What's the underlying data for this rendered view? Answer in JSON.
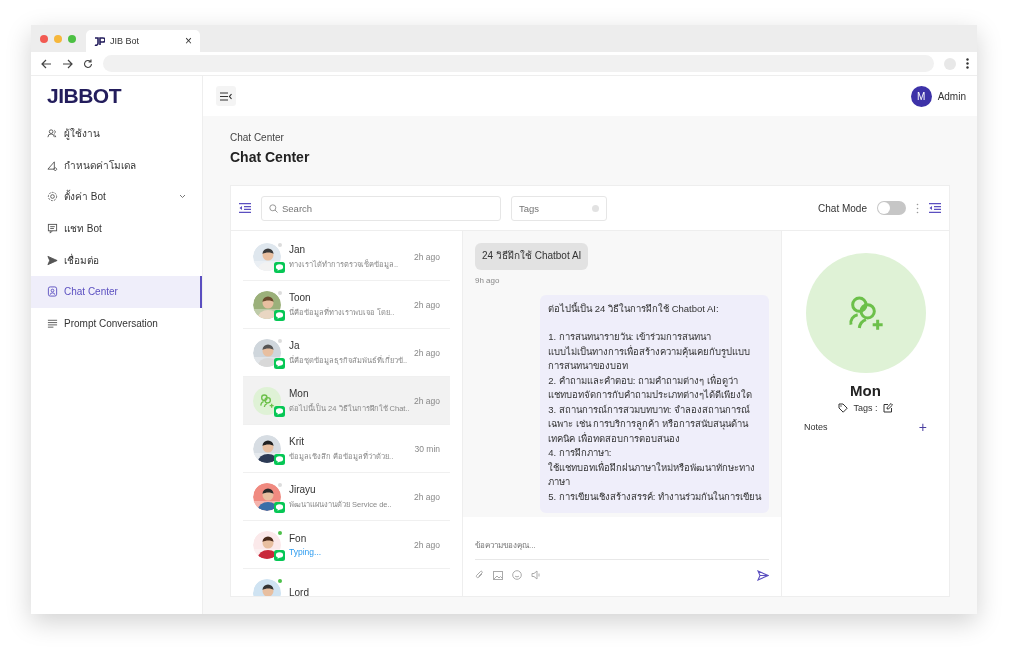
{
  "browser": {
    "tab_title": "JIB Bot",
    "tab_close": "×"
  },
  "sidebar": {
    "logo": "JIBBOT",
    "items": [
      {
        "label": "ผู้ใช้งาน",
        "selected": false,
        "expandable": false
      },
      {
        "label": "กำหนดค่าโมเดล",
        "selected": false,
        "expandable": false
      },
      {
        "label": "ตั้งค่า Bot",
        "selected": false,
        "expandable": true
      },
      {
        "label": "แชท Bot",
        "selected": false,
        "expandable": false
      },
      {
        "label": "เชื่อมต่อ",
        "selected": false,
        "expandable": false
      },
      {
        "label": "Chat Center",
        "selected": true,
        "expandable": false
      },
      {
        "label": "Prompt Conversation",
        "selected": false,
        "expandable": false
      }
    ]
  },
  "header": {
    "avatar_initial": "M",
    "user": "Admin"
  },
  "page": {
    "breadcrumb": "Chat Center",
    "title": "Chat Center"
  },
  "toolbar": {
    "search_placeholder": "Search",
    "tags_placeholder": "Tags",
    "chat_mode_label": "Chat Mode",
    "chat_mode_on": false
  },
  "contacts": [
    {
      "name": "Jan",
      "preview": "ทางเราได้ทำการตรวจเช็คข้อมูล..",
      "time": "2h ago",
      "selected": false,
      "online": false
    },
    {
      "name": "Toon",
      "preview": "นี่คือข้อมูลที่ทางเราพบเจอ โดย..",
      "time": "2h ago",
      "selected": false,
      "online": false
    },
    {
      "name": "Ja",
      "preview": "นี่คือชุดข้อมูลธุรกิจสัมพันธ์ที่เกี่ยวข้..",
      "time": "2h ago",
      "selected": false,
      "online": false
    },
    {
      "name": "Mon",
      "preview": "ต่อไปนี้เป็น 24 วิธีในการฝึกใช้ Chat..",
      "time": "2h ago",
      "selected": true,
      "kind": "placeholder"
    },
    {
      "name": "Krit",
      "preview": "ข้อมูลเชิงลึก คือข้อมูลที่ว่าด้วย..",
      "time": "30 min",
      "selected": false
    },
    {
      "name": "Jirayu",
      "preview": "พัฒนาแผนงานด้วย Service de..",
      "time": "2h ago",
      "selected": false,
      "online": false
    },
    {
      "name": "Fon",
      "preview": "Typing...",
      "time": "2h ago",
      "selected": false,
      "online": true,
      "typing": true
    },
    {
      "name": "Lord",
      "selected": false,
      "online": true
    }
  ],
  "conversation": {
    "messages": [
      {
        "kind": "incoming",
        "paragraphs": [
          [
            "24 วิธีฝึกใช้ Chatbot AI"
          ]
        ],
        "time": "9h ago"
      },
      {
        "kind": "outgoing",
        "paragraphs": [
          [
            "ต่อไปนี้เป็น 24 วิธีในการฝึกใช้ Chatbot AI:"
          ],
          [
            "1. การสนทนารายวัน: เข้าร่วมการสนทนา",
            "แบบไม่เป็นทางการเพื่อสร้างความคุ้นเคยกับรูปแบบ",
            "การสนทนาของบอท",
            "2. คำถามและคำตอบ: ถามคำถามต่างๆ เพื่อดูว่า",
            "แชทบอทจัดการกับคำถามประเภทต่างๆได้ดีเพียงใด",
            "3. สถานการณ์การสวมบทบาท: จำลองสถานการณ์",
            "เฉพาะ เช่น การบริการลูกค้า หรือการสนับสนุนด้าน",
            "เทคนิค เพื่อทดสอบการตอบสนอง",
            "4. การฝึกภาษา:",
            "ใช้แชทบอทเพื่อฝึกฝนภาษาใหม่หรือพัฒนาทักษะทาง",
            "ภาษา",
            "5. การเขียนเชิงสร้างสรรค์: ทำงานร่วมกันในการเขียน"
          ]
        ]
      }
    ],
    "composer": {
      "placeholder": "ข้อความของคุณ..."
    }
  },
  "profile": {
    "name": "Mon",
    "tags_label": "Tags :",
    "notes_label": "Notes",
    "add_note": "+"
  }
}
